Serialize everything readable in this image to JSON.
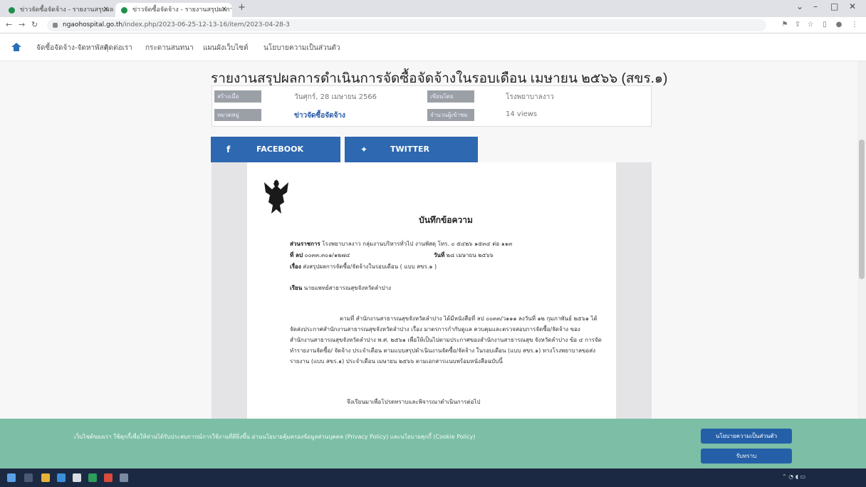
{
  "browser": {
    "tabs": [
      {
        "label": "ข่าวจัดซื้อจัดจ้าง - รายงานสรุปผลการ"
      },
      {
        "label": "ข่าวจัดซื้อจัดจ้าง - รายงานสรุปผลการ"
      }
    ],
    "url_host": "ngaohospital.go.th",
    "url_path": "/index.php/2023-06-25-12-13-16/item/2023-04-28-3"
  },
  "site_nav": {
    "items": [
      "จัดซื้อจัดจ้าง-จัดหาพัสดุ",
      "ติดต่อเรา",
      "กระดานสนทนา",
      "แผนผังเว็บไซต์",
      "นโยบายความเป็นส่วนตัว"
    ]
  },
  "article": {
    "title": "รายงานสรุปผลการดำเนินการจัดซื้อจัดจ้างในรอบเดือน เมษายน ๒๕๖๖ (สขร.๑)",
    "meta": {
      "created_label": "สร้างเมื่อ",
      "created_value": "วันศุกร์, 28 เมษายน 2566",
      "author_label": "เขียนโดย",
      "author_value": "โรงพยาบาลงาว",
      "category_label": "หมวดหมู่",
      "category_value": "ข่าวจัดซื้อจัดจ้าง",
      "views_label": "จำนวนผู้เข้าชม",
      "views_value": "14 views"
    },
    "share": {
      "facebook_label": "FACEBOOK",
      "twitter_label": "TWITTER"
    }
  },
  "memo": {
    "title": "บันทึกข้อความ",
    "agency_label": "ส่วนราชการ",
    "agency_value": "โรงพยาบาลงาว กลุ่มงานบริหารทั่วไป งานพัสดุ โทร. ๐ ๕๔๒๖ ๑๕๓๔ ต่อ ๑๑๓",
    "ref_label": "ที่ ลป",
    "ref_value": "๐๐๓๓.๓๐๑/๑๒๗๔",
    "date_label": "วันที่",
    "date_value": "๒๘ เมษายน ๒๕๖๖",
    "subject_label": "เรื่อง",
    "subject_value": "ส่งสรุปผลการจัดซื้อ/จัดจ้างในรอบเดือน ( แบบ สขร.๑ )",
    "to_label": "เรียน",
    "to_value": "นายแพทย์สาธารณสุขจังหวัดลำปาง",
    "body": "ตามที่ สำนักงานสาธารณสุขจังหวัดลำปาง ได้มีหนังสือที่ ลป ๐๐๓๓/ว๑๑๑ ลงวันที่ ๑๒ กุมภาพันธ์ ๒๕๖๑ ได้จัดส่งประกาศสำนักงานสาธารณสุขจังหวัดลำปาง เรื่อง มาตรการกำกับดูแล ควบคุมและตรวจสอบการจัดซื้อ/จัดจ้าง ของสำนักงานสาธารณสุขจังหวัดลำปาง พ.ศ. ๒๕๖๑ เพื่อให้เป็นไปตามประกาศของสำนักงานสาธารณสุข จังหวัดลำปาง ข้อ ๔ การจัดทำรายงานจัดซื้อ/ จัดจ้าง ประจำเดือน ตามแบบสรุปดำเนินงานจัดซื้อ/จัดจ้าง ในรอบเดือน (แบบ สขร.๑) ทางโรงพยาบาลขอส่งรายงาน (แบบ สขร.๑) ประจำเดือน เมษายน ๒๕๖๖ ตามเอกสารแนบพร้อมหนังสือฉบับนี้",
    "closing": "จึงเรียนมาเพื่อโปรดทราบและพิจารณาดำเนินการต่อไป"
  },
  "cookie_banner": {
    "text": "เว็บไซต์ของเรา ใช้คุกกี้เพื่อให้ท่านได้รับประสบการณ์การใช้งานที่ดียิ่งขึ้น อ่านนโยบายคุ้มครองข้อมูลส่วนบุคคล (Privacy Policy) และนโยบายคุกกี้ (Cookie Policy)",
    "privacy_button": "นโยบายความเป็นส่วนตัว",
    "accept_button": "รับทราบ"
  },
  "icons": {
    "home": "home-icon",
    "facebook": "facebook-icon",
    "twitter": "twitter-icon",
    "emblem": "garuda-emblem"
  },
  "colors": {
    "share_blue": "#2d68b0",
    "cookie_green": "#7dbfa6",
    "button_blue": "#245fa8"
  }
}
